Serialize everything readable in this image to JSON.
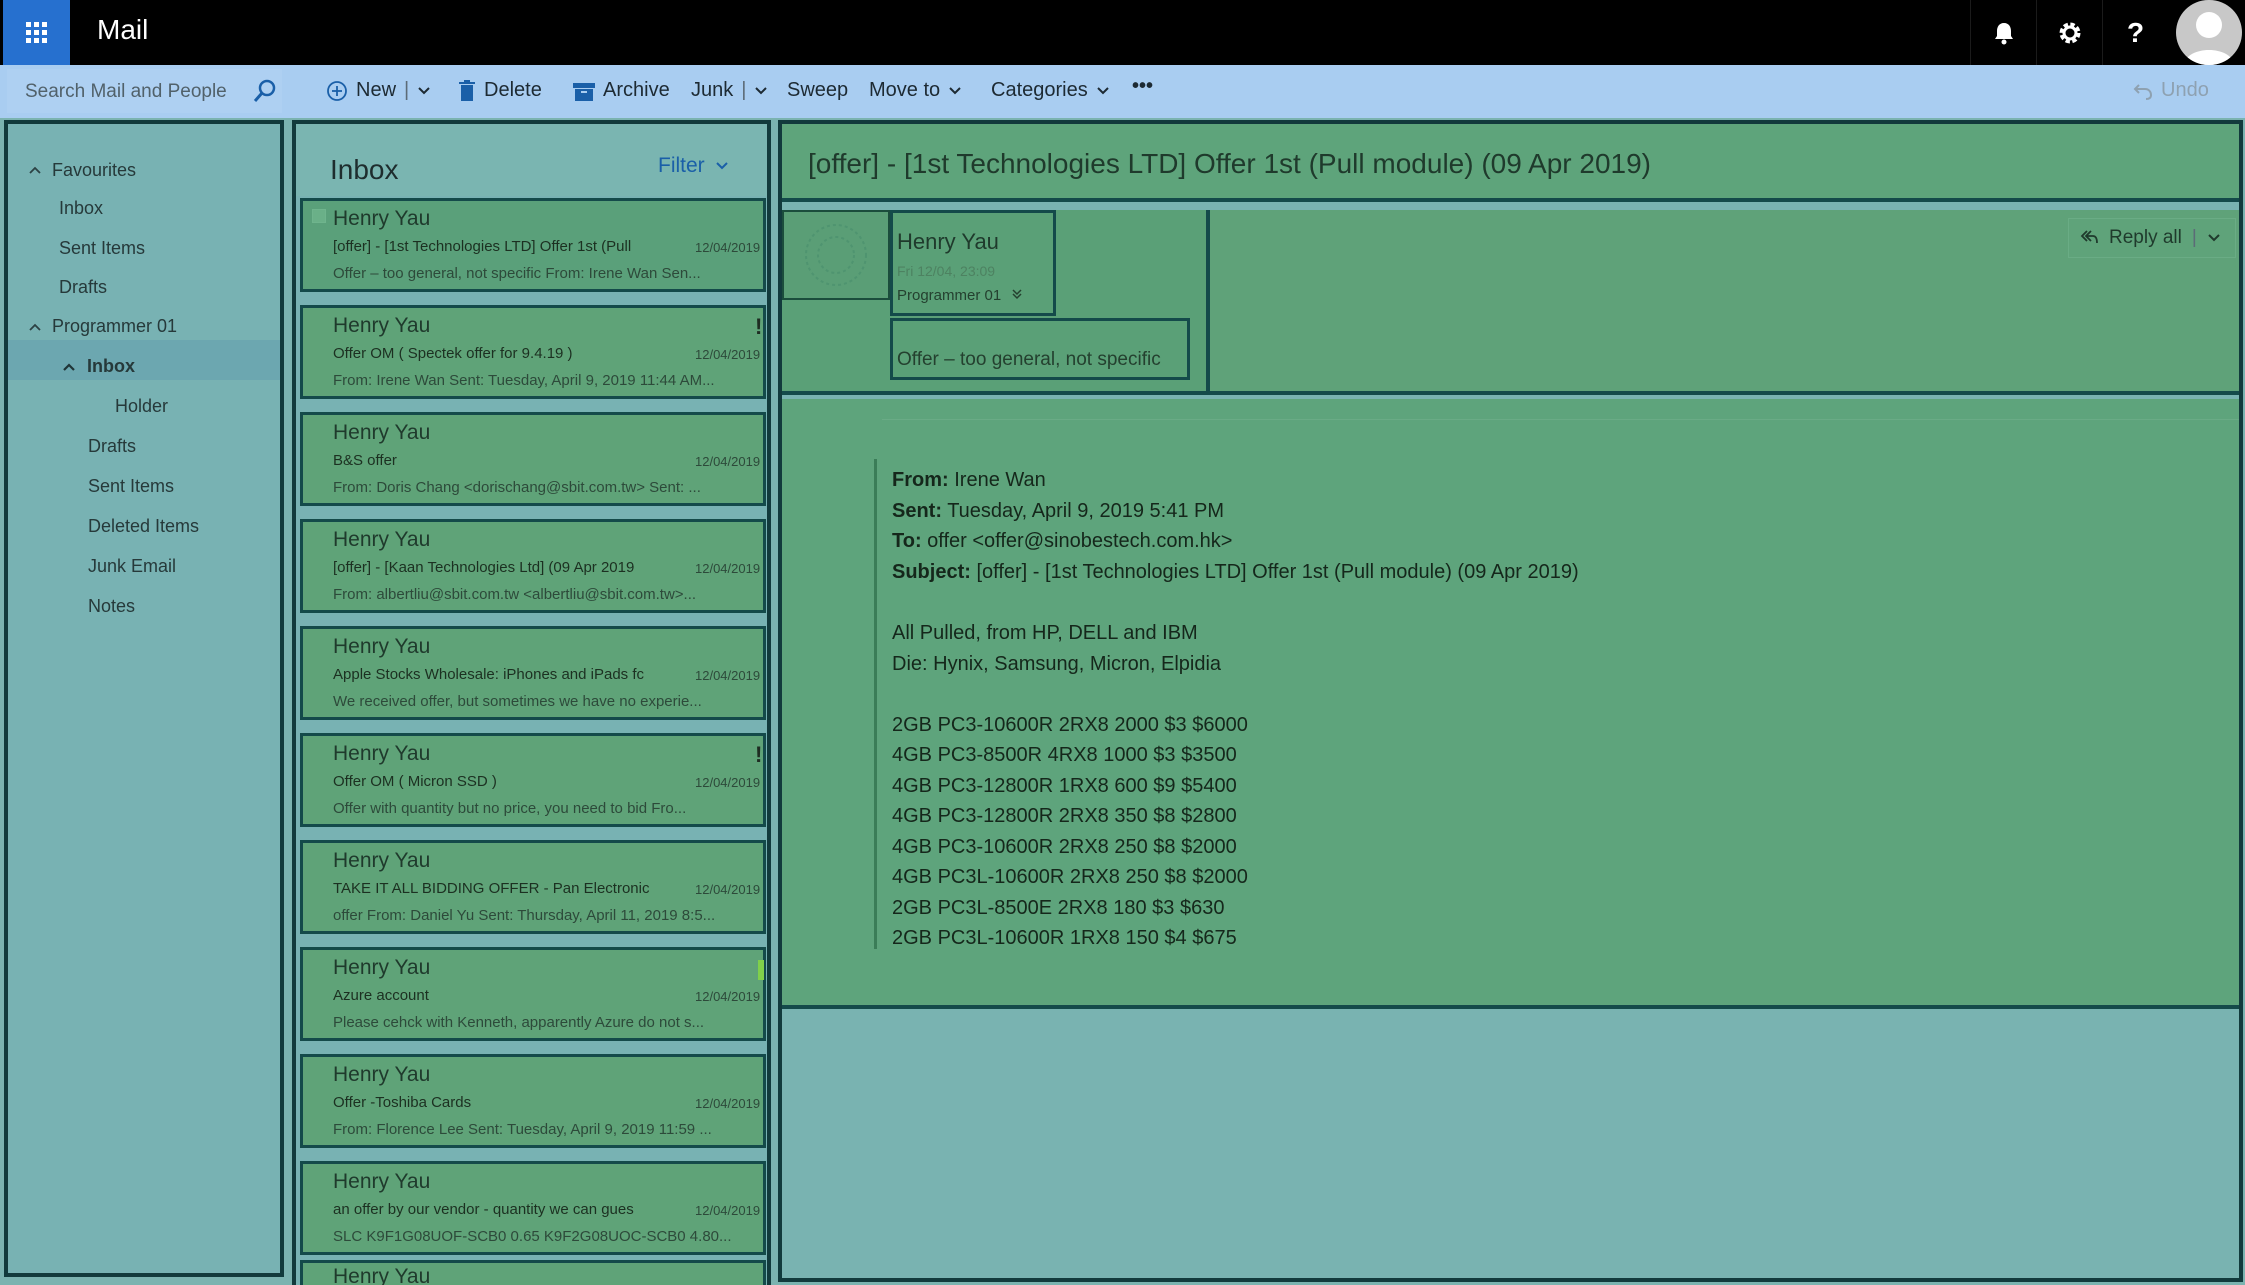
{
  "app": {
    "title": "Mail"
  },
  "cmd": {
    "search_placeholder": "Search Mail and People",
    "new": "New",
    "delete": "Delete",
    "archive": "Archive",
    "junk": "Junk",
    "sweep": "Sweep",
    "move_to": "Move to",
    "categories": "Categories",
    "more": "•••",
    "undo": "Undo"
  },
  "folders": {
    "favourites": "Favourites",
    "fav_inbox": "Inbox",
    "fav_sent": "Sent Items",
    "fav_drafts": "Drafts",
    "account": "Programmer 01",
    "inbox": "Inbox",
    "holder": "Holder",
    "drafts": "Drafts",
    "sent": "Sent Items",
    "deleted": "Deleted Items",
    "junk": "Junk Email",
    "notes": "Notes"
  },
  "list": {
    "title": "Inbox",
    "filter": "Filter",
    "messages": [
      {
        "sender": "Henry Yau",
        "subject": "[offer] - [1st Technologies LTD] Offer 1st (Pull",
        "date": "12/04/2019",
        "preview": "Offer – too general, not specific From: Irene Wan Sen..."
      },
      {
        "sender": "Henry Yau",
        "subject": "Offer OM ( Spectek offer for 9.4.19 )",
        "date": "12/04/2019",
        "preview": "From: Irene Wan Sent: Tuesday, April 9, 2019 11:44 AM...",
        "flag": "!"
      },
      {
        "sender": "Henry Yau",
        "subject": "B&S offer",
        "date": "12/04/2019",
        "preview": "From: Doris Chang <dorischang@sbit.com.tw> Sent: ..."
      },
      {
        "sender": "Henry Yau",
        "subject": "[offer] - [Kaan Technologies Ltd] (09 Apr 2019",
        "date": "12/04/2019",
        "preview": "From: albertliu@sbit.com.tw <albertliu@sbit.com.tw>..."
      },
      {
        "sender": "Henry Yau",
        "subject": "Apple Stocks Wholesale: iPhones and iPads fc",
        "date": "12/04/2019",
        "preview": "We received offer, but sometimes we have no experie..."
      },
      {
        "sender": "Henry Yau",
        "subject": "Offer OM ( Micron SSD )",
        "date": "12/04/2019",
        "preview": "Offer with quantity but no price, you need to bid Fro...",
        "flag": "!"
      },
      {
        "sender": "Henry Yau",
        "subject": "TAKE IT ALL BIDDING OFFER - Pan Electronic",
        "date": "12/04/2019",
        "preview": "offer From: Daniel Yu Sent: Thursday, April 11, 2019 8:5..."
      },
      {
        "sender": "Henry Yau",
        "subject": "Azure account",
        "date": "12/04/2019",
        "preview": "Please cehck with Kenneth, apparently Azure do not s..."
      },
      {
        "sender": "Henry Yau",
        "subject": "Offer -Toshiba Cards",
        "date": "12/04/2019",
        "preview": "From: Florence Lee Sent: Tuesday, April 9, 2019 11:59 ..."
      },
      {
        "sender": "Henry Yau",
        "subject": "an offer by our vendor - quantity we can gues",
        "date": "12/04/2019",
        "preview": "SLC K9F1G08UOF-SCB0 0.65 K9F2G08UOC-SCB0 4.80..."
      }
    ],
    "cut_sender": "Henry Yau"
  },
  "reading": {
    "subject": "[offer] - [1st Technologies LTD] Offer 1st (Pull module) (09 Apr 2019)",
    "sender": "Henry Yau",
    "time": "Fri 12/04, 23:09",
    "folder": "Programmer 01",
    "preview": "Offer – too general, not specific",
    "reply_all": "Reply all",
    "body": {
      "from_label": "From:",
      "from": " Irene Wan",
      "sent_label": "Sent:",
      "sent": " Tuesday, April 9, 2019 5:41 PM",
      "to_label": "To:",
      "to": " offer <offer@sinobestech.com.hk>",
      "subject_label": "Subject:",
      "subject": " [offer] - [1st Technologies LTD] Offer 1st (Pull module) (09 Apr 2019)",
      "line1": "All Pulled, from HP, DELL and IBM",
      "line2": "Die: Hynix, Samsung, Micron, Elpidia",
      "items": [
        "2GB PC3-10600R 2RX8 2000 $3 $6000",
        "4GB PC3-8500R 4RX8 1000 $3 $3500",
        "4GB PC3-12800R 1RX8 600 $9 $5400",
        "4GB PC3-12800R 2RX8 350 $8 $2800",
        "4GB PC3-10600R 2RX8 250 $8 $2000",
        "4GB PC3L-10600R 2RX8 250 $8 $2000",
        "2GB PC3L-8500E 2RX8 180 $3 $630",
        "2GB PC3L-10600R 1RX8 150 $4 $675"
      ]
    }
  }
}
